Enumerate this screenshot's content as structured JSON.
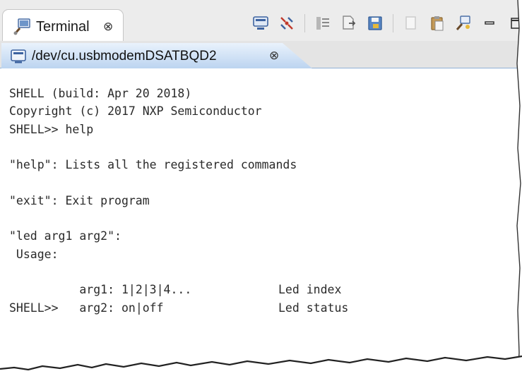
{
  "view": {
    "tab_label": "Terminal",
    "tab_close": "⊗",
    "toolbar_icons": [
      "terminal-connect-icon",
      "disconnect-icon",
      "settings-icon",
      "export-icon",
      "save-icon",
      "copy-icon",
      "paste-icon",
      "pin-icon",
      "minimize-icon",
      "maximize-icon"
    ]
  },
  "session": {
    "tab_label": "/dev/cu.usbmodemDSATBQD2",
    "tab_close": "⊗"
  },
  "console": {
    "lines": [
      "SHELL (build: Apr 20 2018)",
      "Copyright (c) 2017 NXP Semiconductor",
      "SHELL>> help",
      "",
      "\"help\": Lists all the registered commands",
      "",
      "\"exit\": Exit program",
      "",
      "\"led arg1 arg2\":",
      " Usage:"
    ],
    "arg1_left": "    arg1: 1|2|3|4...",
    "arg1_right": "Led index",
    "arg2_left": "    arg2: on|off",
    "arg2_right": "Led status",
    "prompt": "SHELL>>"
  },
  "colors": {
    "accent_tab": "#bcd4f0",
    "text": "#2a2a2a"
  }
}
